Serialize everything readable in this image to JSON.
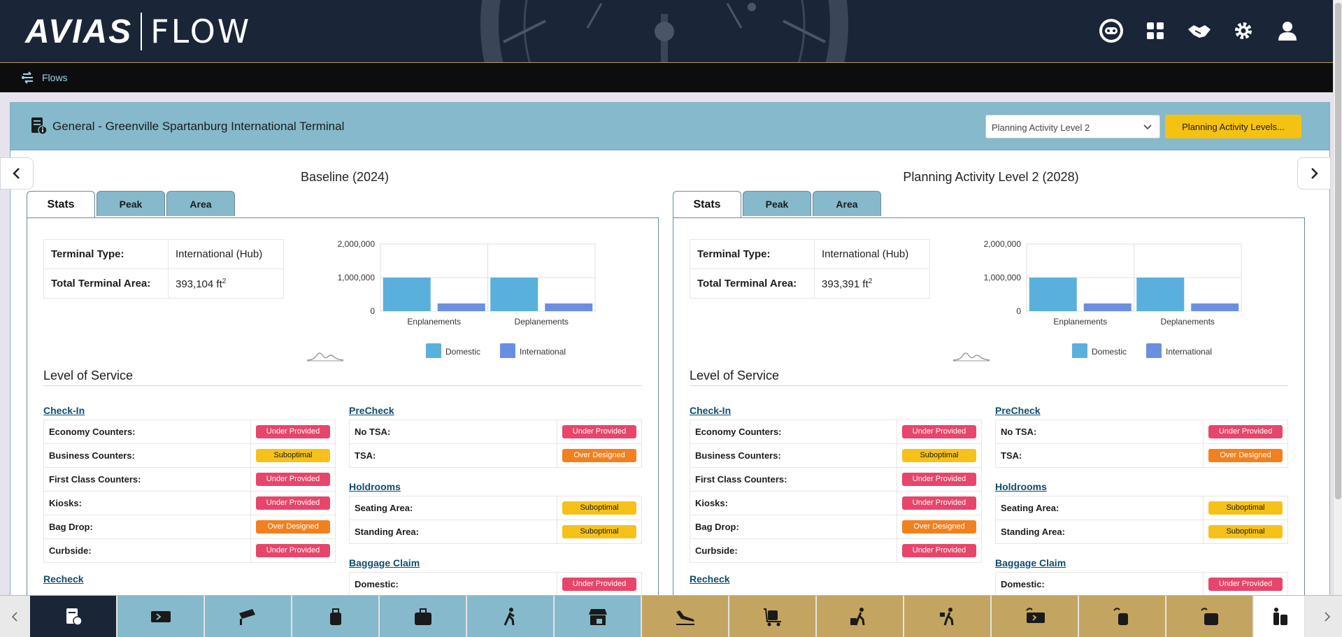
{
  "app": {
    "brand": "AVIAS",
    "product": "FLOW"
  },
  "header_icons": [
    "robot-assistant-icon",
    "apps-grid-icon",
    "handshake-icon",
    "gear-icon",
    "user-icon"
  ],
  "nav": {
    "flows_label": "Flows"
  },
  "card": {
    "title": "General - Greenville Spartanburg International Terminal",
    "select_value": "Planning Activity Level 2",
    "levels_button": "Planning Activity Levels..."
  },
  "tabs": [
    "Stats",
    "Peak",
    "Area"
  ],
  "labels": {
    "terminal_type": "Terminal Type:",
    "total_area": "Total Terminal Area:",
    "area_unit": "ft",
    "area_sup": "2",
    "los_title": "Level of Service"
  },
  "panels": [
    {
      "title": "Baseline (2024)",
      "terminal_type": "International (Hub)",
      "total_area": "393,104"
    },
    {
      "title": "Planning Activity Level 2 (2028)",
      "terminal_type": "International (Hub)",
      "total_area": "393,391"
    }
  ],
  "chart_data": [
    {
      "type": "bar",
      "categories": [
        "Enplanements",
        "Deplanements"
      ],
      "series": [
        {
          "name": "Domestic",
          "values": [
            1000000,
            1000000
          ],
          "color": "#5ab0dc"
        },
        {
          "name": "International",
          "values": [
            230000,
            230000
          ],
          "color": "#6a8fe0"
        }
      ],
      "ylim": [
        0,
        2000000
      ],
      "yticks": [
        "2,000,000",
        "1,000,000",
        "0"
      ],
      "legend": "bottom"
    },
    {
      "type": "bar",
      "categories": [
        "Enplanements",
        "Deplanements"
      ],
      "series": [
        {
          "name": "Domestic",
          "values": [
            1000000,
            1000000
          ],
          "color": "#5ab0dc"
        },
        {
          "name": "International",
          "values": [
            230000,
            230000
          ],
          "color": "#6a8fe0"
        }
      ],
      "ylim": [
        0,
        2000000
      ],
      "yticks": [
        "2,000,000",
        "1,000,000",
        "0"
      ],
      "legend": "bottom"
    }
  ],
  "los": {
    "checkin": {
      "title": "Check-In",
      "rows": [
        {
          "label": "Economy Counters:",
          "status": "Under Provided",
          "tone": "red"
        },
        {
          "label": "Business Counters:",
          "status": "Suboptimal",
          "tone": "yellow"
        },
        {
          "label": "First Class Counters:",
          "status": "Under Provided",
          "tone": "red"
        },
        {
          "label": "Kiosks:",
          "status": "Under Provided",
          "tone": "red"
        },
        {
          "label": "Bag Drop:",
          "status": "Over Designed",
          "tone": "orange"
        },
        {
          "label": "Curbside:",
          "status": "Under Provided",
          "tone": "red"
        }
      ]
    },
    "precheck": {
      "title": "PreCheck",
      "rows": [
        {
          "label": "No TSA:",
          "status": "Under Provided",
          "tone": "red"
        },
        {
          "label": "TSA:",
          "status": "Over Designed",
          "tone": "orange"
        }
      ]
    },
    "holdrooms": {
      "title": "Holdrooms",
      "rows": [
        {
          "label": "Seating Area:",
          "status": "Suboptimal",
          "tone": "yellow"
        },
        {
          "label": "Standing Area:",
          "status": "Suboptimal",
          "tone": "yellow"
        }
      ]
    },
    "baggage": {
      "title": "Baggage Claim",
      "rows": [
        {
          "label": "Domestic:",
          "status": "Under Provided",
          "tone": "red"
        }
      ]
    },
    "recheck": {
      "title": "Recheck"
    }
  },
  "bottom_items": [
    {
      "icon": "terminal-info-icon",
      "tone": "dark"
    },
    {
      "icon": "ticket-icon",
      "tone": "blue"
    },
    {
      "icon": "security-camera-icon",
      "tone": "blue"
    },
    {
      "icon": "carry-on-bag-icon",
      "tone": "blue"
    },
    {
      "icon": "suitcase-icon",
      "tone": "blue"
    },
    {
      "icon": "walking-person-icon",
      "tone": "blue"
    },
    {
      "icon": "duty-free-shop-icon",
      "tone": "blue"
    },
    {
      "icon": "plane-landing-icon",
      "tone": "gold"
    },
    {
      "icon": "baggage-cart-icon",
      "tone": "gold"
    },
    {
      "icon": "traveler-luggage-icon",
      "tone": "gold"
    },
    {
      "icon": "traveler-lock-icon",
      "tone": "gold"
    },
    {
      "icon": "transfer-ticket-icon",
      "tone": "gold"
    },
    {
      "icon": "transfer-bag-icon",
      "tone": "gold"
    },
    {
      "icon": "transfer-suitcase-icon",
      "tone": "gold"
    },
    {
      "icon": "passenger-icon",
      "tone": "white"
    }
  ]
}
